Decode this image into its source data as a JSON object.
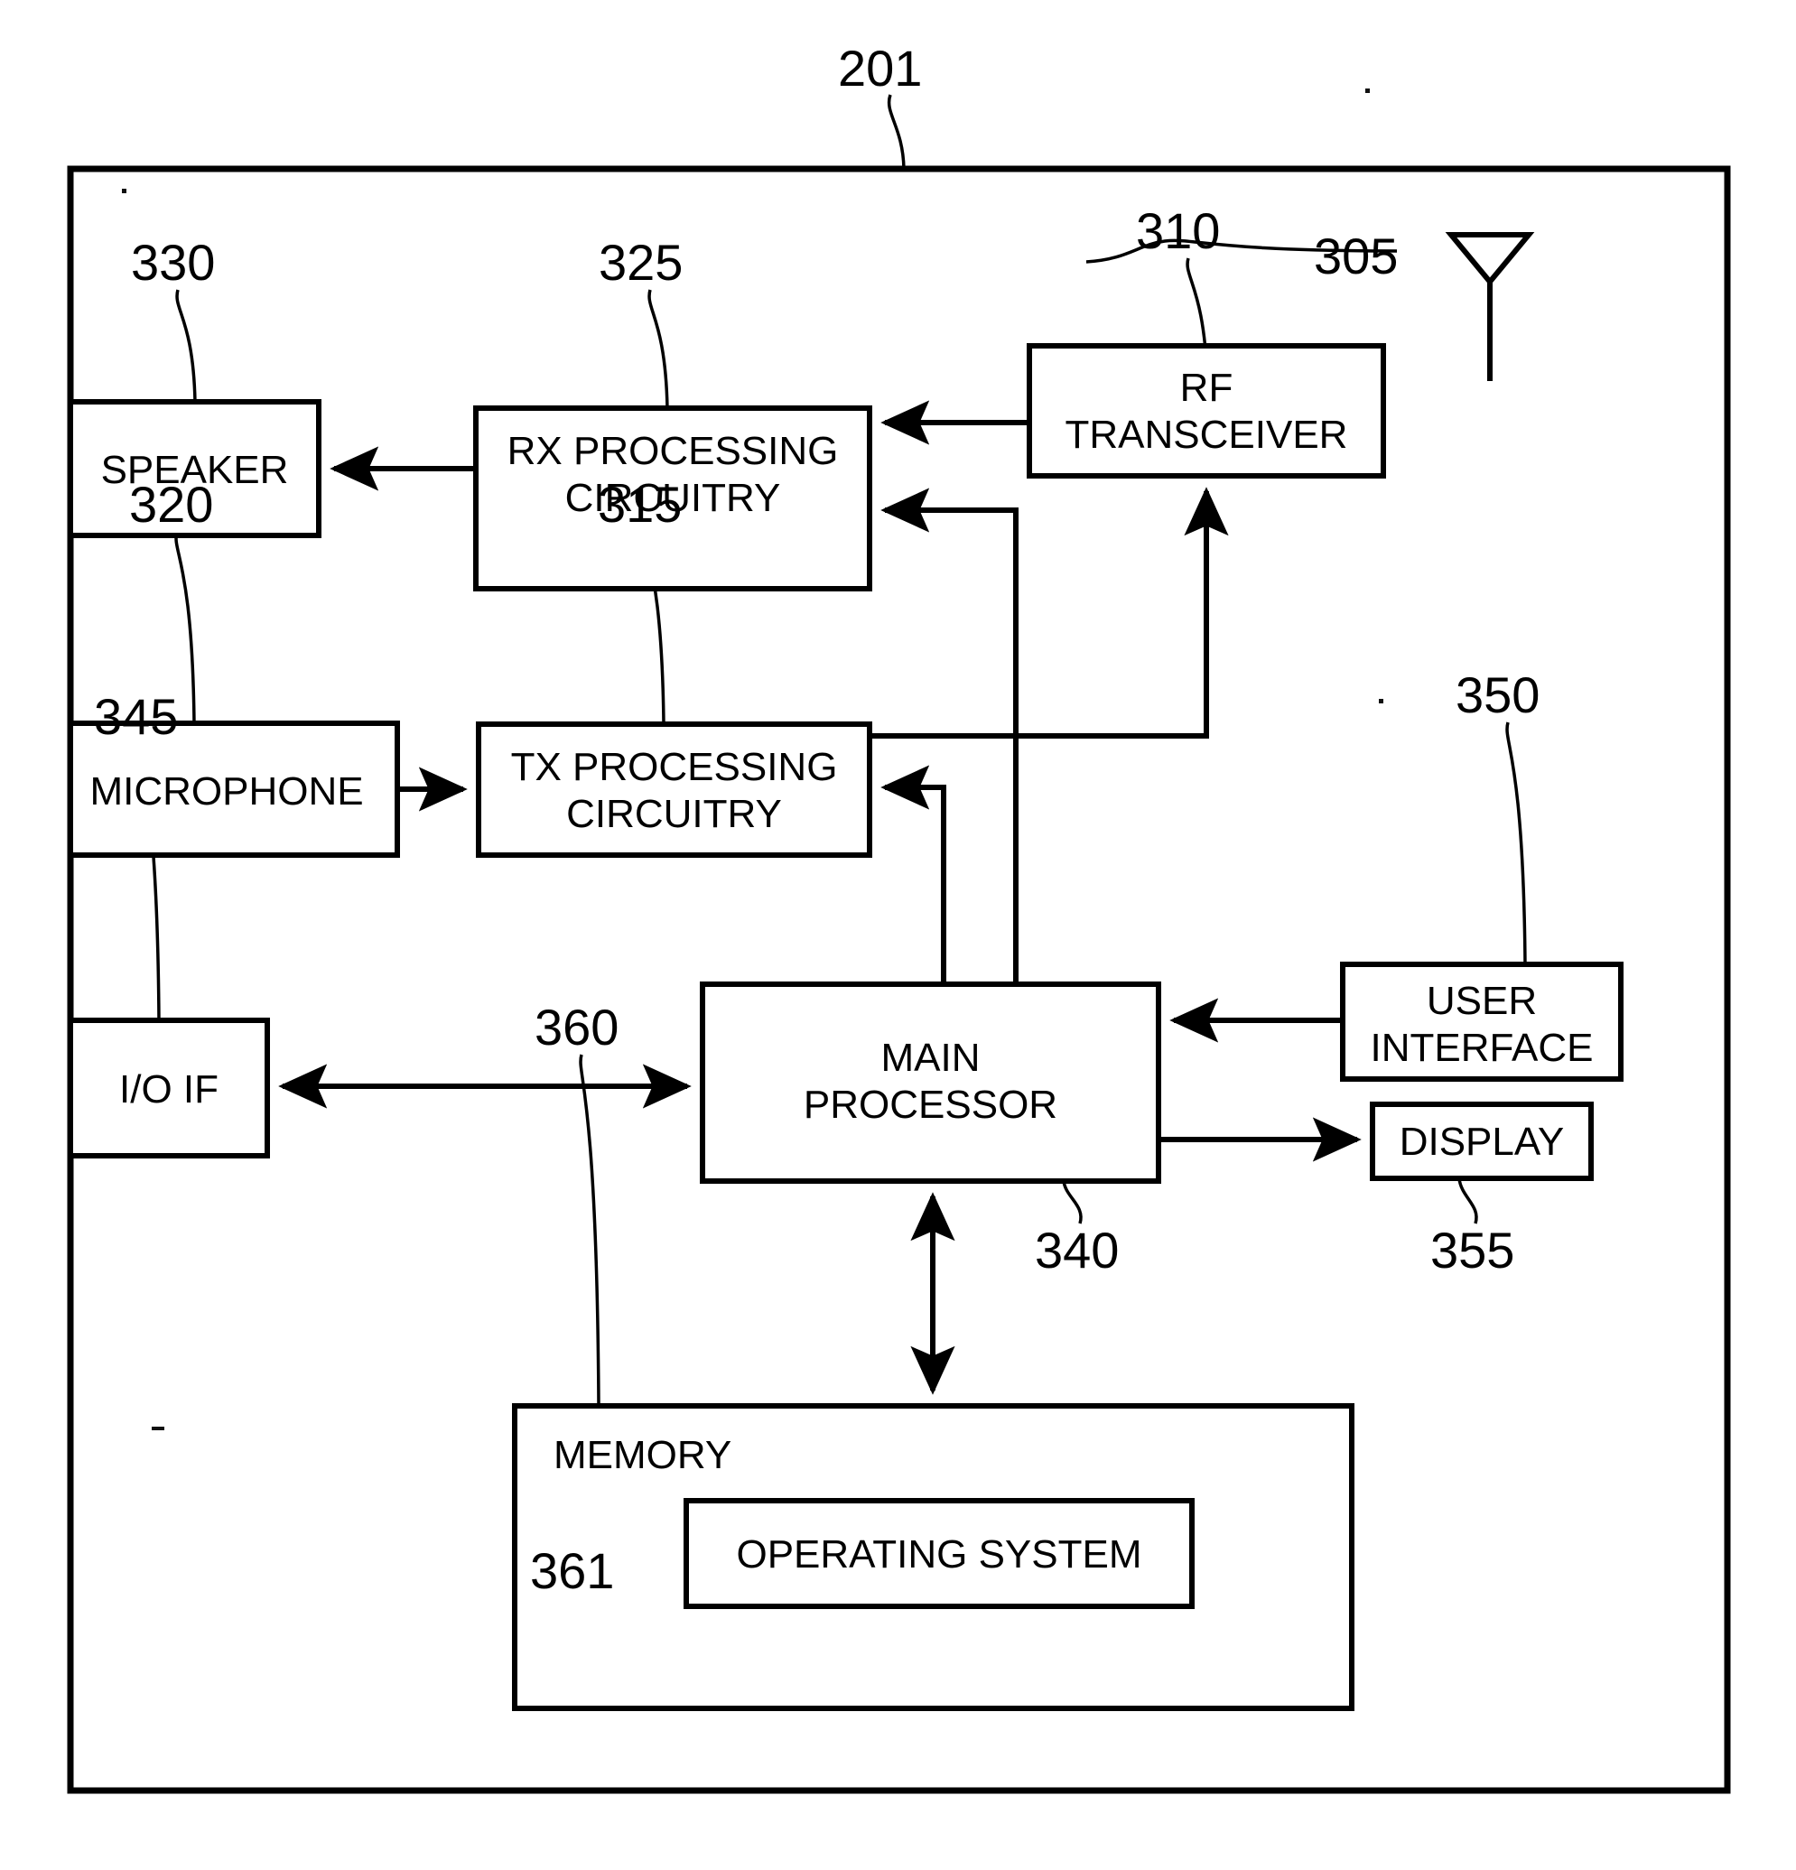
{
  "figure": {
    "outer_box_ref": "201",
    "type": "block-diagram",
    "title_ref": "201"
  },
  "reference_numerals": {
    "outer_device": "201",
    "antenna": "305",
    "rf_transceiver": "310",
    "tx_processing": "315",
    "microphone": "320",
    "rx_processing": "325",
    "speaker": "330",
    "main_processor": "340",
    "io_if": "345",
    "user_interface": "350",
    "display": "355",
    "memory": "360",
    "operating_system": "361"
  },
  "blocks": {
    "speaker": {
      "label": "SPEAKER",
      "ref": "330"
    },
    "rx_processing": {
      "label": "RX PROCESSING\nCIRCUITRY",
      "ref": "325"
    },
    "rf_transceiver": {
      "label": "RF\nTRANSCEIVER",
      "ref": "310"
    },
    "microphone": {
      "label": "MICROPHONE",
      "ref": "320"
    },
    "tx_processing": {
      "label": "TX PROCESSING\nCIRCUITRY",
      "ref": "315"
    },
    "io_if": {
      "label": "I/O IF",
      "ref": "345"
    },
    "main_processor": {
      "label": "MAIN\nPROCESSOR",
      "ref": "340"
    },
    "user_interface": {
      "label": "USER\nINTERFACE",
      "ref": "350"
    },
    "display": {
      "label": "DISPLAY",
      "ref": "355"
    },
    "memory": {
      "label": "MEMORY",
      "ref": "360"
    },
    "operating_system": {
      "label": "OPERATING SYSTEM",
      "ref": "361"
    }
  },
  "connections": [
    {
      "from": "rf_transceiver",
      "to": "rx_processing",
      "arrow": "single"
    },
    {
      "from": "rx_processing",
      "to": "speaker",
      "arrow": "single"
    },
    {
      "from": "microphone",
      "to": "tx_processing",
      "arrow": "single"
    },
    {
      "from": "tx_processing",
      "to": "rf_transceiver",
      "arrow": "single"
    },
    {
      "from": "main_processor",
      "to": "rx_processing",
      "arrow": "single"
    },
    {
      "from": "main_processor",
      "to": "tx_processing",
      "arrow": "single"
    },
    {
      "from": "tx_processing",
      "to": "main_processor",
      "arrow": "single"
    },
    {
      "from": "rx_processing",
      "to": "main_processor",
      "arrow": "single"
    },
    {
      "from": "io_if",
      "to": "main_processor",
      "arrow": "double"
    },
    {
      "from": "user_interface",
      "to": "main_processor",
      "arrow": "single"
    },
    {
      "from": "main_processor",
      "to": "display",
      "arrow": "single"
    },
    {
      "from": "main_processor",
      "to": "memory",
      "arrow": "double"
    },
    {
      "from": "antenna",
      "to": "rf_transceiver",
      "arrow": "none"
    }
  ],
  "colors": {
    "ink": "#000000",
    "paper": "#ffffff"
  }
}
